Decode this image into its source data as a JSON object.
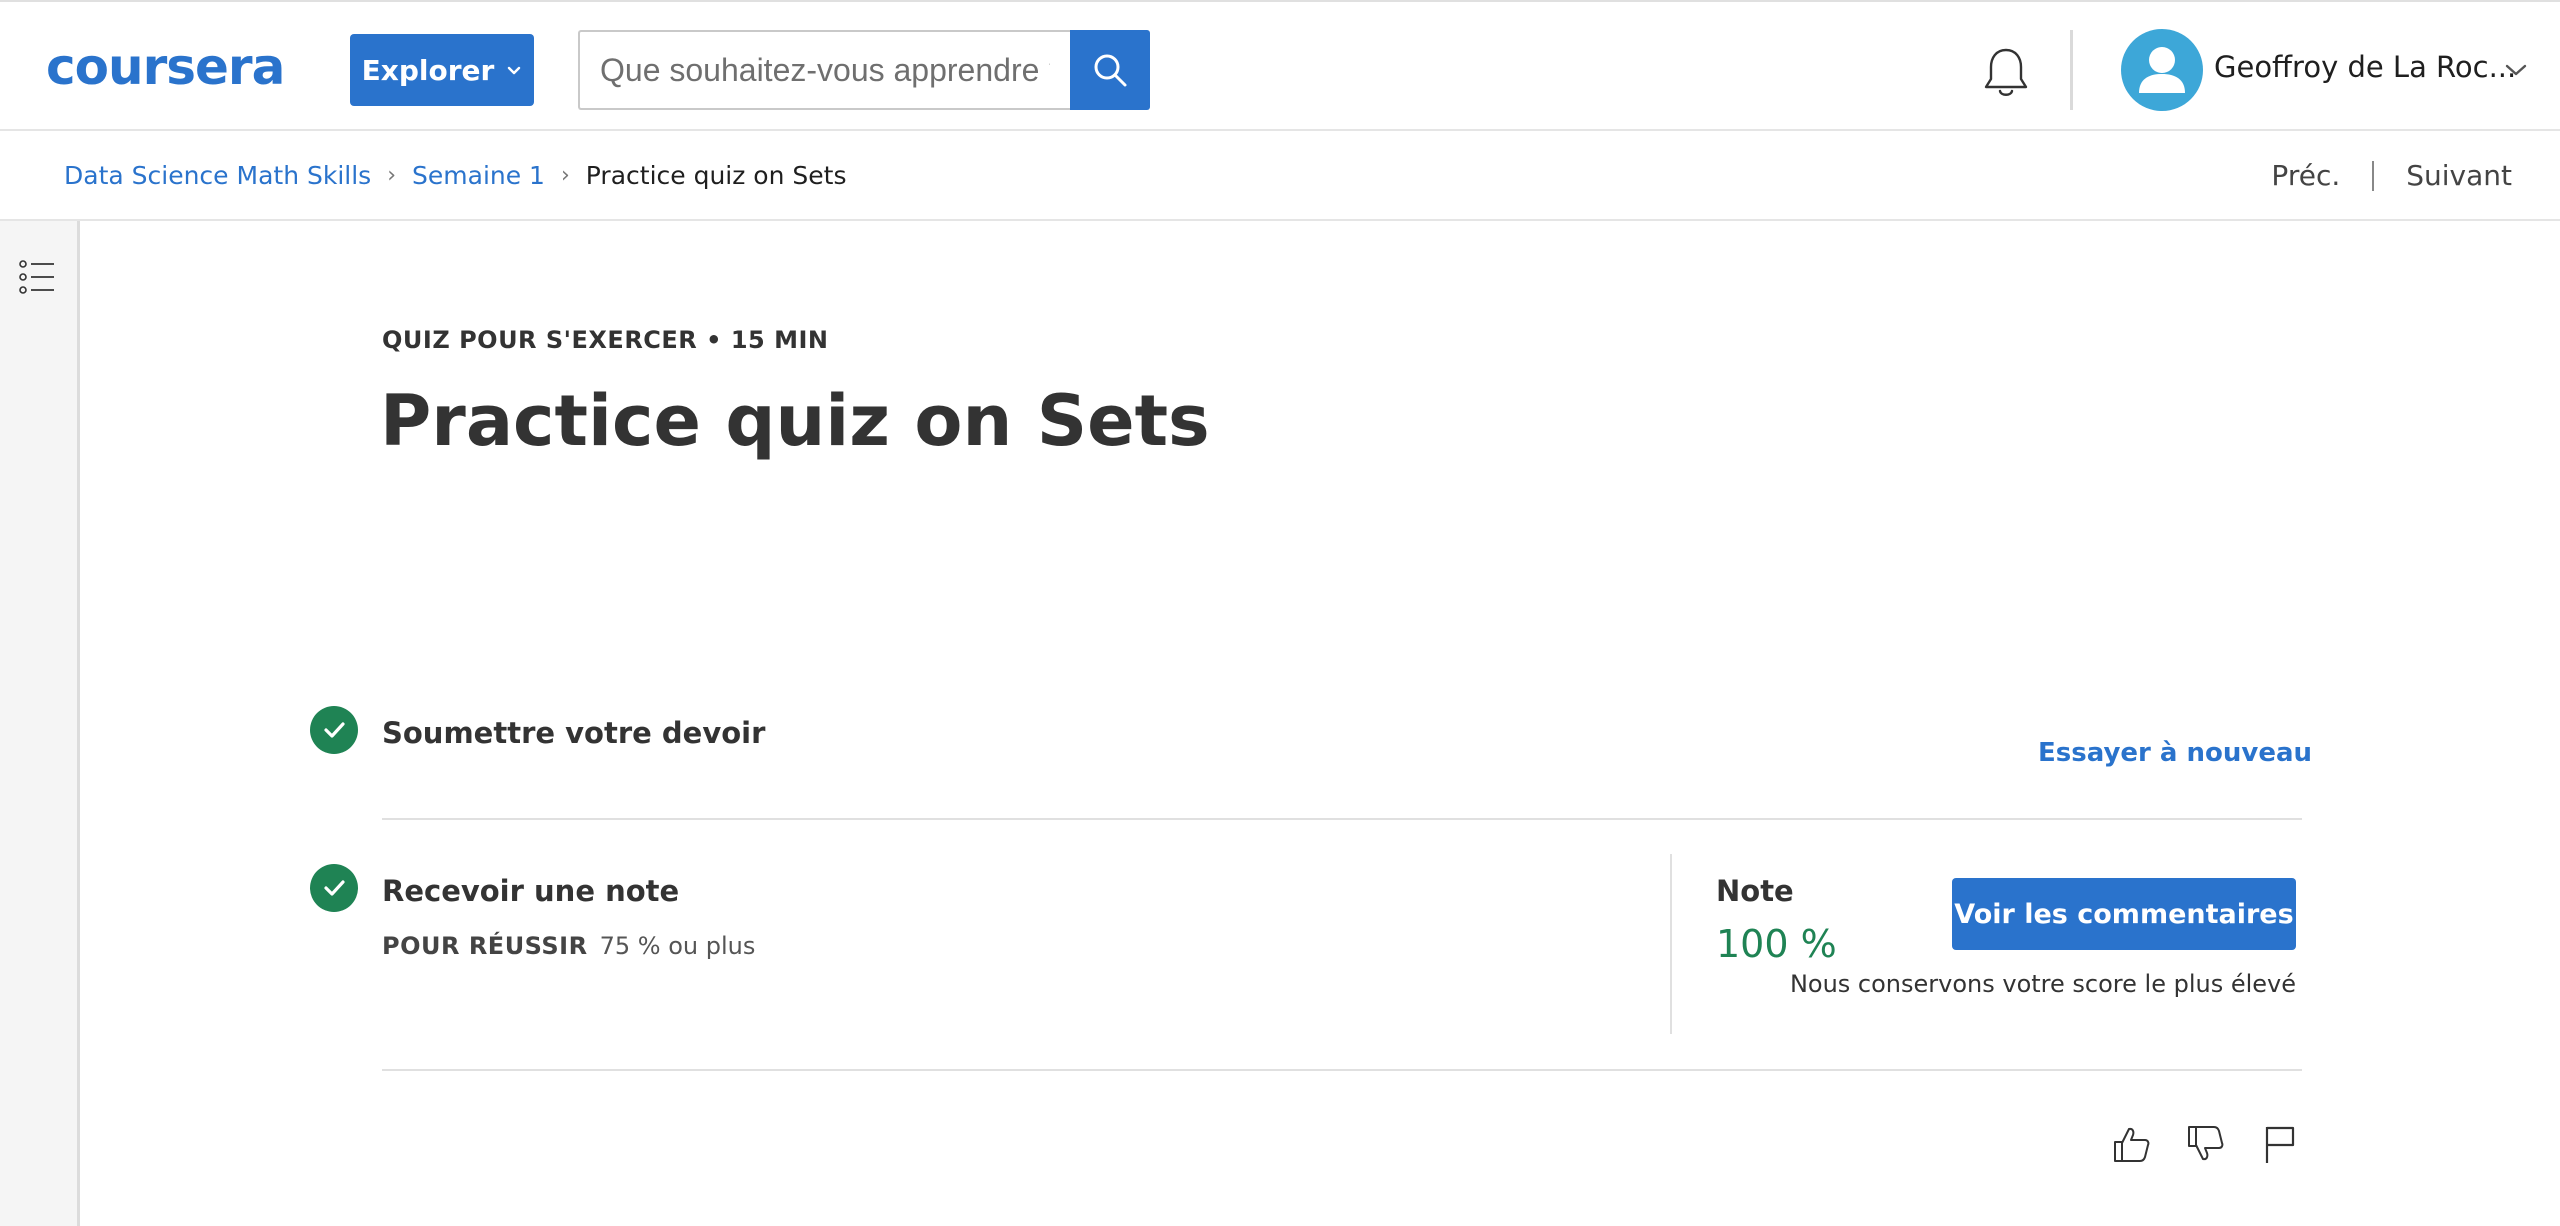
{
  "header": {
    "logo_text": "coursera",
    "explore_label": "Explorer",
    "search": {
      "placeholder": "Que souhaitez-vous apprendre ?",
      "value": ""
    },
    "user_name": "Geoffroy de La Roc...",
    "brand_color": "#2a73cc"
  },
  "breadcrumb": {
    "items": [
      "Data Science Math Skills",
      "Semaine 1",
      "Practice quiz on Sets"
    ],
    "prev_label": "Préc.",
    "next_label": "Suivant"
  },
  "main": {
    "meta": "QUIZ POUR S'EXERCER • 15  MIN",
    "title": "Practice quiz on Sets",
    "step_submit": {
      "label": "Soumettre votre devoir",
      "action_label": "Essayer à nouveau",
      "status_color": "#1f8354"
    },
    "step_grade": {
      "label": "Recevoir une note",
      "pass_label": "POUR RÉUSSIR",
      "pass_value": "75 % ou plus",
      "grade_label": "Note",
      "grade_value": "100 %",
      "feedback_button": "Voir les commentaires",
      "keep_note": "Nous conservons votre score le plus élevé"
    }
  },
  "icons": {
    "search": "search-icon",
    "bell": "bell-icon",
    "avatar": "user-avatar-icon",
    "toc": "table-of-contents-icon",
    "like": "thumbs-up-icon",
    "dislike": "thumbs-down-icon",
    "flag": "flag-icon"
  }
}
